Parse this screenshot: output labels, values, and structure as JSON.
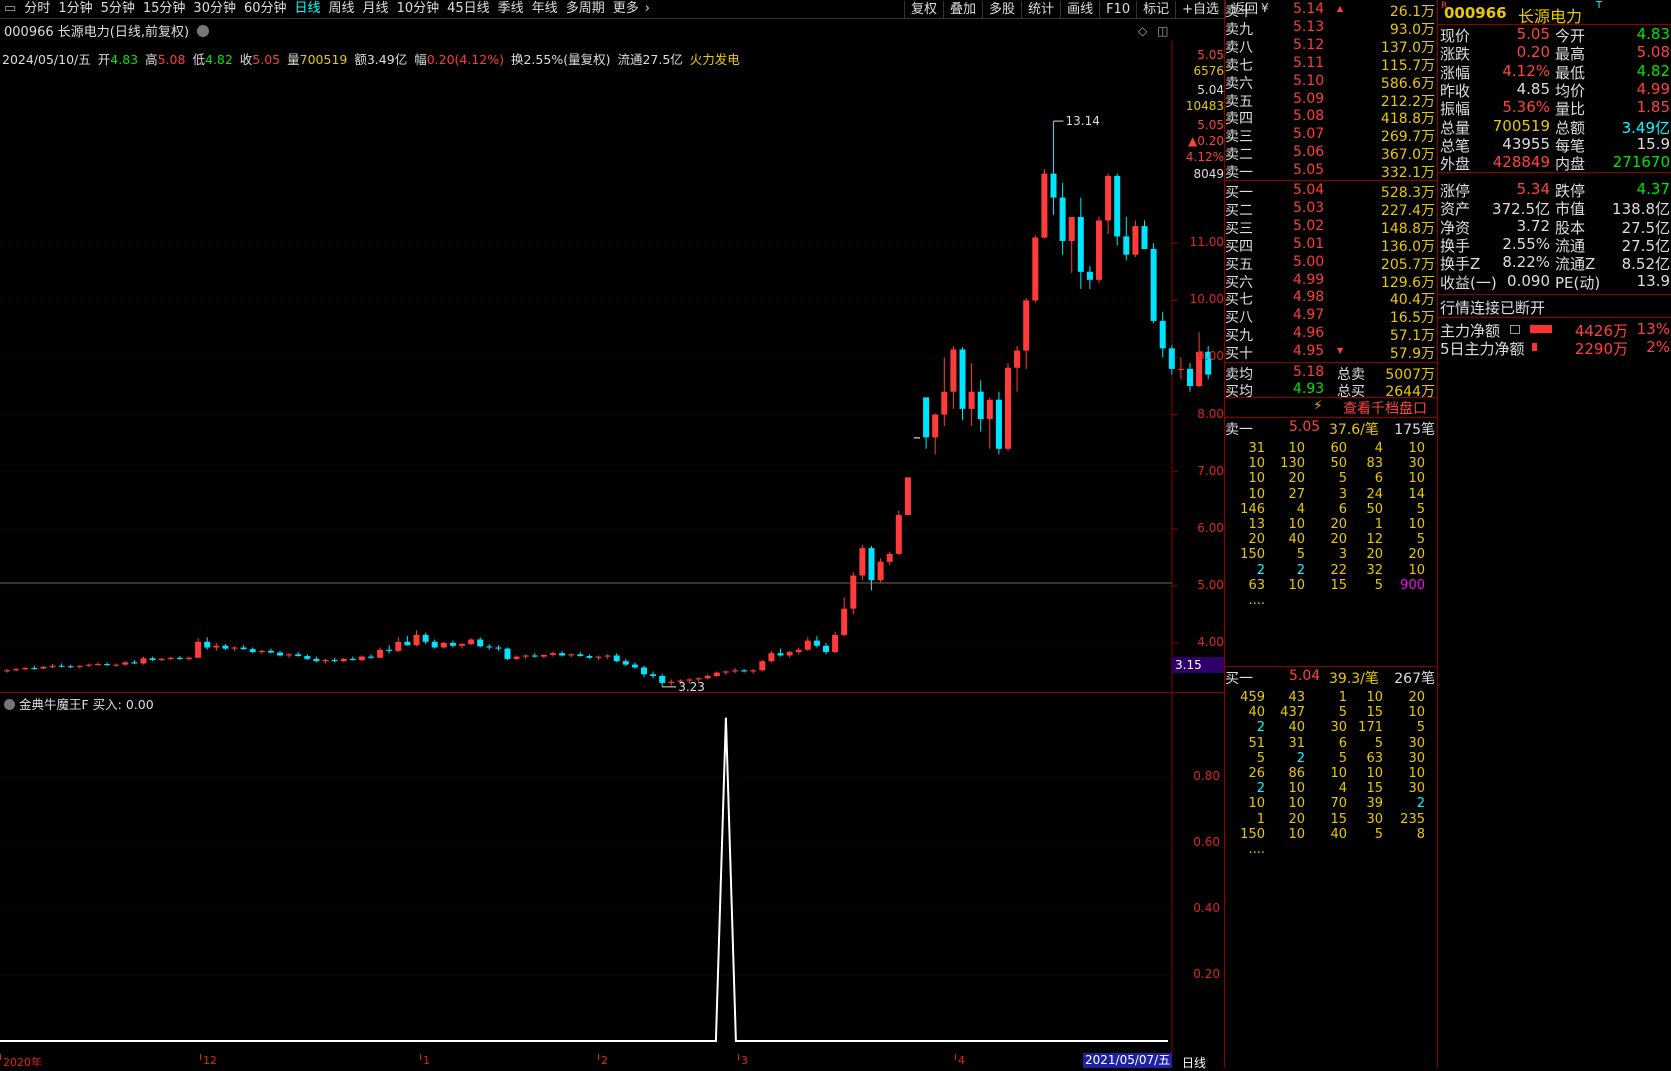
{
  "toolbar": {
    "periods": [
      "分时",
      "1分钟",
      "5分钟",
      "15分钟",
      "30分钟",
      "60分钟",
      "日线",
      "周线",
      "月线",
      "10分钟",
      "45日线",
      "季线",
      "年线",
      "多周期",
      "更多"
    ],
    "active": "日线",
    "right_buttons": [
      "复权",
      "叠加",
      "多股",
      "统计",
      "画线",
      "F10",
      "标记",
      "+自选",
      "返回"
    ]
  },
  "chart": {
    "title": "000966 长源电力(日线,前复权)",
    "ohlc": {
      "date": "2024/05/10/五",
      "open_label": "开",
      "open": "4.83",
      "high_label": "高",
      "high": "5.08",
      "low_label": "低",
      "low": "4.82",
      "close_label": "收",
      "close": "5.05",
      "vol_label": "量",
      "vol": "700519",
      "amt_label": "额",
      "amt": "3.49亿",
      "chg_label": "幅",
      "chg": "0.20(4.12%)",
      "turn": "换2.55%(量复权)",
      "float": "流通27.5亿",
      "sector": "火力发电"
    },
    "axis_top": [
      "5.05",
      "6576",
      "5.04",
      "10483",
      "5.05",
      "▲0.20",
      "4.12%",
      "8049"
    ],
    "price_ticks": [
      "11.00",
      "10.00",
      "9.00",
      "8.00",
      "7.00",
      "6.00",
      "5.00",
      "4.00"
    ],
    "price_marker": "3.15",
    "max_label": "13.14",
    "min_label": "3.23",
    "x_labels": [
      "2020年",
      "12",
      "1",
      "2",
      "3",
      "4"
    ],
    "date_tag": "2021/05/07/五",
    "period_tag": "日线"
  },
  "indicator": {
    "title": "金典牛魔王F  买入: 0.00",
    "ticks": [
      "0.80",
      "0.60",
      "0.40",
      "0.20"
    ]
  },
  "chart_data": {
    "type": "candlestick",
    "title": "000966 长源电力(日线,前复权)",
    "ylim": [
      3.0,
      14.0
    ],
    "candles": [
      [
        3.5,
        3.55,
        3.48,
        3.52
      ],
      [
        3.52,
        3.56,
        3.5,
        3.54
      ],
      [
        3.54,
        3.58,
        3.52,
        3.56
      ],
      [
        3.56,
        3.6,
        3.53,
        3.55
      ],
      [
        3.55,
        3.6,
        3.54,
        3.58
      ],
      [
        3.58,
        3.63,
        3.56,
        3.6
      ],
      [
        3.6,
        3.64,
        3.57,
        3.59
      ],
      [
        3.59,
        3.62,
        3.56,
        3.58
      ],
      [
        3.58,
        3.61,
        3.55,
        3.6
      ],
      [
        3.6,
        3.64,
        3.58,
        3.62
      ],
      [
        3.62,
        3.66,
        3.6,
        3.63
      ],
      [
        3.63,
        3.66,
        3.6,
        3.61
      ],
      [
        3.61,
        3.64,
        3.58,
        3.62
      ],
      [
        3.62,
        3.68,
        3.6,
        3.66
      ],
      [
        3.66,
        3.7,
        3.63,
        3.64
      ],
      [
        3.64,
        3.76,
        3.62,
        3.73
      ],
      [
        3.73,
        3.76,
        3.68,
        3.7
      ],
      [
        3.7,
        3.74,
        3.68,
        3.72
      ],
      [
        3.72,
        3.76,
        3.7,
        3.74
      ],
      [
        3.74,
        3.77,
        3.7,
        3.72
      ],
      [
        3.72,
        3.76,
        3.69,
        3.74
      ],
      [
        3.74,
        4.08,
        3.73,
        4.02
      ],
      [
        4.02,
        4.1,
        3.88,
        3.92
      ],
      [
        3.92,
        4.0,
        3.86,
        3.95
      ],
      [
        3.95,
        3.98,
        3.88,
        3.9
      ],
      [
        3.9,
        3.94,
        3.86,
        3.92
      ],
      [
        3.92,
        3.96,
        3.88,
        3.89
      ],
      [
        3.89,
        3.92,
        3.82,
        3.84
      ],
      [
        3.84,
        3.88,
        3.8,
        3.86
      ],
      [
        3.86,
        3.9,
        3.82,
        3.83
      ],
      [
        3.83,
        3.86,
        3.76,
        3.78
      ],
      [
        3.78,
        3.82,
        3.74,
        3.8
      ],
      [
        3.8,
        3.84,
        3.76,
        3.77
      ],
      [
        3.77,
        3.8,
        3.7,
        3.72
      ],
      [
        3.72,
        3.76,
        3.66,
        3.68
      ],
      [
        3.68,
        3.72,
        3.64,
        3.7
      ],
      [
        3.7,
        3.74,
        3.66,
        3.68
      ],
      [
        3.68,
        3.74,
        3.66,
        3.72
      ],
      [
        3.72,
        3.76,
        3.69,
        3.7
      ],
      [
        3.7,
        3.78,
        3.68,
        3.76
      ],
      [
        3.76,
        3.8,
        3.72,
        3.74
      ],
      [
        3.74,
        3.92,
        3.73,
        3.88
      ],
      [
        3.88,
        3.96,
        3.82,
        3.86
      ],
      [
        3.86,
        4.1,
        3.84,
        4.02
      ],
      [
        4.02,
        4.12,
        3.95,
        3.96
      ],
      [
        3.96,
        4.22,
        3.94,
        4.14
      ],
      [
        4.14,
        4.18,
        3.98,
        4.02
      ],
      [
        4.02,
        4.06,
        3.9,
        3.92
      ],
      [
        3.92,
        4.02,
        3.9,
        4.0
      ],
      [
        4.0,
        4.04,
        3.92,
        3.95
      ],
      [
        3.95,
        4.0,
        3.9,
        3.98
      ],
      [
        3.98,
        4.08,
        3.96,
        4.06
      ],
      [
        4.06,
        4.1,
        3.92,
        3.94
      ],
      [
        3.94,
        3.98,
        3.88,
        3.92
      ],
      [
        3.92,
        3.96,
        3.86,
        3.9
      ],
      [
        3.9,
        3.92,
        3.7,
        3.72
      ],
      [
        3.72,
        3.78,
        3.7,
        3.76
      ],
      [
        3.76,
        3.8,
        3.72,
        3.78
      ],
      [
        3.78,
        3.82,
        3.74,
        3.76
      ],
      [
        3.76,
        3.8,
        3.73,
        3.79
      ],
      [
        3.79,
        3.85,
        3.76,
        3.82
      ],
      [
        3.82,
        3.86,
        3.76,
        3.78
      ],
      [
        3.78,
        3.82,
        3.75,
        3.8
      ],
      [
        3.8,
        3.84,
        3.76,
        3.77
      ],
      [
        3.77,
        3.8,
        3.72,
        3.74
      ],
      [
        3.74,
        3.78,
        3.7,
        3.76
      ],
      [
        3.76,
        3.8,
        3.72,
        3.78
      ],
      [
        3.78,
        3.82,
        3.66,
        3.68
      ],
      [
        3.68,
        3.72,
        3.6,
        3.62
      ],
      [
        3.62,
        3.66,
        3.55,
        3.57
      ],
      [
        3.57,
        3.6,
        3.4,
        3.45
      ],
      [
        3.45,
        3.5,
        3.38,
        3.42
      ],
      [
        3.42,
        3.46,
        3.23,
        3.3
      ],
      [
        3.3,
        3.36,
        3.25,
        3.32
      ],
      [
        3.32,
        3.36,
        3.28,
        3.34
      ],
      [
        3.34,
        3.38,
        3.3,
        3.36
      ],
      [
        3.36,
        3.4,
        3.32,
        3.38
      ],
      [
        3.38,
        3.45,
        3.36,
        3.42
      ],
      [
        3.42,
        3.5,
        3.4,
        3.48
      ],
      [
        3.48,
        3.52,
        3.44,
        3.5
      ],
      [
        3.5,
        3.56,
        3.47,
        3.52
      ],
      [
        3.52,
        3.54,
        3.48,
        3.5
      ],
      [
        3.5,
        3.54,
        3.46,
        3.52
      ],
      [
        3.52,
        3.7,
        3.5,
        3.68
      ],
      [
        3.68,
        3.86,
        3.66,
        3.82
      ],
      [
        3.82,
        3.9,
        3.76,
        3.78
      ],
      [
        3.78,
        3.86,
        3.74,
        3.84
      ],
      [
        3.84,
        3.92,
        3.8,
        3.88
      ],
      [
        3.88,
        4.1,
        3.86,
        4.04
      ],
      [
        4.04,
        4.12,
        3.92,
        3.95
      ],
      [
        3.95,
        4.0,
        3.8,
        3.84
      ],
      [
        3.84,
        4.2,
        3.82,
        4.14
      ],
      [
        4.14,
        4.8,
        4.12,
        4.6
      ],
      [
        4.6,
        5.24,
        4.5,
        5.18
      ],
      [
        5.18,
        5.72,
        5.1,
        5.66
      ],
      [
        5.66,
        5.7,
        4.92,
        5.1
      ],
      [
        5.1,
        5.48,
        5.06,
        5.42
      ],
      [
        5.42,
        5.6,
        5.36,
        5.56
      ],
      [
        5.56,
        6.32,
        5.54,
        6.24
      ],
      [
        6.24,
        6.9,
        6.24,
        6.9
      ],
      [
        7.6,
        7.6,
        7.6,
        7.6
      ],
      [
        8.3,
        8.3,
        7.4,
        7.6
      ],
      [
        7.6,
        8.02,
        7.3,
        8.0
      ],
      [
        8.0,
        9.0,
        7.8,
        8.4
      ],
      [
        8.4,
        9.2,
        8.1,
        9.14
      ],
      [
        9.14,
        9.18,
        7.9,
        8.1
      ],
      [
        8.1,
        8.9,
        7.8,
        8.4
      ],
      [
        8.4,
        8.6,
        7.7,
        7.92
      ],
      [
        7.92,
        8.3,
        7.4,
        8.26
      ],
      [
        8.26,
        8.4,
        7.3,
        7.4
      ],
      [
        7.4,
        8.9,
        7.36,
        8.82
      ],
      [
        8.82,
        9.2,
        8.4,
        9.12
      ],
      [
        9.12,
        10.04,
        8.8,
        10.0
      ],
      [
        10.0,
        11.14,
        9.96,
        11.1
      ],
      [
        11.1,
        12.3,
        11.08,
        12.22
      ],
      [
        12.22,
        13.14,
        11.5,
        11.8
      ],
      [
        11.8,
        12.06,
        10.8,
        11.04
      ],
      [
        11.04,
        11.4,
        10.48,
        11.46
      ],
      [
        11.46,
        11.8,
        10.2,
        10.5
      ],
      [
        10.5,
        10.6,
        10.2,
        10.36
      ],
      [
        10.36,
        11.46,
        10.3,
        11.4
      ],
      [
        11.4,
        12.22,
        11.16,
        12.18
      ],
      [
        12.18,
        12.22,
        10.96,
        11.12
      ],
      [
        11.12,
        11.46,
        10.7,
        10.8
      ],
      [
        10.8,
        11.4,
        10.76,
        11.3
      ],
      [
        11.3,
        11.4,
        10.9,
        10.9
      ],
      [
        10.9,
        11.0,
        9.6,
        9.64
      ],
      [
        9.64,
        9.8,
        9.0,
        9.16
      ],
      [
        9.16,
        9.22,
        8.7,
        8.8
      ],
      [
        8.8,
        9.0,
        8.62,
        8.8
      ],
      [
        8.8,
        8.9,
        8.4,
        8.5
      ],
      [
        8.5,
        9.44,
        8.48,
        9.1
      ],
      [
        9.1,
        9.2,
        8.62,
        8.7
      ]
    ]
  },
  "book": {
    "sells": [
      {
        "n": "卖十",
        "p": "5.14",
        "q": "26.1万",
        "mark": "¥",
        "arrow": "▲"
      },
      {
        "n": "卖九",
        "p": "5.13",
        "q": "93.0万"
      },
      {
        "n": "卖八",
        "p": "5.12",
        "q": "137.0万"
      },
      {
        "n": "卖七",
        "p": "5.11",
        "q": "115.7万"
      },
      {
        "n": "卖六",
        "p": "5.10",
        "q": "586.6万"
      },
      {
        "n": "卖五",
        "p": "5.09",
        "q": "212.2万"
      },
      {
        "n": "卖四",
        "p": "5.08",
        "q": "418.8万"
      },
      {
        "n": "卖三",
        "p": "5.07",
        "q": "269.7万"
      },
      {
        "n": "卖二",
        "p": "5.06",
        "q": "367.0万"
      },
      {
        "n": "卖一",
        "p": "5.05",
        "q": "332.1万"
      }
    ],
    "buys": [
      {
        "n": "买一",
        "p": "5.04",
        "q": "528.3万"
      },
      {
        "n": "买二",
        "p": "5.03",
        "q": "227.4万"
      },
      {
        "n": "买三",
        "p": "5.02",
        "q": "148.8万"
      },
      {
        "n": "买四",
        "p": "5.01",
        "q": "136.0万"
      },
      {
        "n": "买五",
        "p": "5.00",
        "q": "205.7万"
      },
      {
        "n": "买六",
        "p": "4.99",
        "q": "129.6万"
      },
      {
        "n": "买七",
        "p": "4.98",
        "q": "40.4万"
      },
      {
        "n": "买八",
        "p": "4.97",
        "q": "16.5万"
      },
      {
        "n": "买九",
        "p": "4.96",
        "q": "57.1万"
      },
      {
        "n": "买十",
        "p": "4.95",
        "q": "57.9万",
        "arrow": "▼"
      }
    ],
    "avg": [
      {
        "n": "卖均",
        "p": "5.18",
        "k": "总卖",
        "q": "5007万"
      },
      {
        "n": "买均",
        "p": "4.93",
        "k": "总买",
        "q": "2644万"
      }
    ],
    "link": "查看千档盘口",
    "sell1": {
      "n": "卖一",
      "p": "5.05",
      "avg": "37.6/笔",
      "cnt": "175笔"
    },
    "sell_queue": [
      [
        "31",
        "10",
        "60",
        "4",
        "10"
      ],
      [
        "10",
        "130",
        "50",
        "83",
        "30"
      ],
      [
        "10",
        "20",
        "5",
        "6",
        "10"
      ],
      [
        "10",
        "27",
        "3",
        "24",
        "14"
      ],
      [
        "146",
        "4",
        "6",
        "50",
        "5"
      ],
      [
        "13",
        "10",
        "20",
        "1",
        "10"
      ],
      [
        "20",
        "40",
        "20",
        "12",
        "5"
      ],
      [
        "150",
        "5",
        "3",
        "20",
        "20"
      ],
      [
        "2",
        "2",
        "22",
        "32",
        "10"
      ],
      [
        "63",
        "10",
        "15",
        "5",
        "900"
      ],
      [
        "....",
        "",
        "",
        "",
        ""
      ]
    ],
    "buy1": {
      "n": "买一",
      "p": "5.04",
      "avg": "39.3/笔",
      "cnt": "267笔"
    },
    "buy_queue": [
      [
        "459",
        "43",
        "1",
        "10",
        "20"
      ],
      [
        "40",
        "437",
        "5",
        "15",
        "10"
      ],
      [
        "2",
        "40",
        "30",
        "171",
        "5"
      ],
      [
        "51",
        "31",
        "6",
        "5",
        "30"
      ],
      [
        "5",
        "2",
        "5",
        "63",
        "30"
      ],
      [
        "26",
        "86",
        "10",
        "10",
        "10"
      ],
      [
        "2",
        "10",
        "4",
        "15",
        "30"
      ],
      [
        "10",
        "10",
        "70",
        "39",
        "2"
      ],
      [
        "1",
        "20",
        "15",
        "30",
        "235"
      ],
      [
        "150",
        "10",
        "40",
        "5",
        "8"
      ],
      [
        "....",
        "",
        "",
        "",
        ""
      ]
    ]
  },
  "info": {
    "code": "000966",
    "name": "长源电力",
    "badge": "R",
    "rows1": [
      [
        "现价",
        "5.05",
        "今开",
        "4.83"
      ],
      [
        "涨跌",
        "0.20",
        "最高",
        "5.08"
      ],
      [
        "涨幅",
        "4.12%",
        "最低",
        "4.82"
      ],
      [
        "昨收",
        "4.85",
        "均价",
        "4.99"
      ],
      [
        "振幅",
        "5.36%",
        "量比",
        "1.85"
      ],
      [
        "总量",
        "700519",
        "总额",
        "3.49亿"
      ],
      [
        "总笔",
        "43955",
        "每笔",
        "15.9"
      ],
      [
        "外盘",
        "428849",
        "内盘",
        "271670"
      ]
    ],
    "rows2": [
      [
        "涨停",
        "5.34",
        "跌停",
        "4.37"
      ],
      [
        "资产",
        "372.5亿",
        "市值",
        "138.8亿"
      ],
      [
        "净资",
        "3.72",
        "股本",
        "27.5亿"
      ],
      [
        "换手",
        "2.55%",
        "流通",
        "27.5亿"
      ],
      [
        "换手Z",
        "8.22%",
        "流通Z",
        "8.52亿"
      ],
      [
        "收益(一)",
        "0.090",
        "PE(动)",
        "13.9"
      ]
    ],
    "status": "行情连接已断开",
    "flows": [
      {
        "k": "主力净额",
        "v": "4426万",
        "pct": "13%",
        "bar": 0.85
      },
      {
        "k": "5日主力净额",
        "v": "2290万",
        "pct": "2%",
        "bar": 0.18
      }
    ]
  },
  "colors": {
    "up": "#ff3b3b",
    "down": "#00e5ff",
    "grid": "#5a0000",
    "axis": "#8b0000"
  }
}
